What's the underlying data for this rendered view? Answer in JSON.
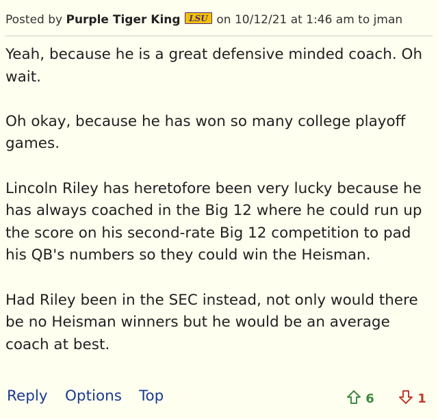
{
  "header": {
    "prefix": "Posted by",
    "author": "Purple Tiger King",
    "team_badge": "LSU",
    "date_text": "on 10/12/21 at 1:46 am to",
    "reply_to": "jman"
  },
  "body": {
    "paragraphs": [
      "Yeah, because he is a great defensive minded coach. Oh wait.",
      "Oh okay, because he has won so many college playoff games.",
      "Lincoln Riley has heretofore been very lucky because he has always coached in the Big 12 where he could run up the score on his second-rate Big 12 competition to pad his QB's numbers so they could win the Heisman.",
      "Had Riley been in the SEC instead, not only would there be no Heisman winners but he would be an average coach at best."
    ]
  },
  "actions": {
    "reply": "Reply",
    "options": "Options",
    "top": "Top"
  },
  "votes": {
    "up_count": "6",
    "down_count": "1",
    "up_icon": "arrow-up-icon",
    "down_icon": "arrow-down-icon",
    "up_color": "#3d8a3d",
    "down_color": "#c0392b"
  },
  "colors": {
    "background": "#fffff0",
    "link": "#1a3a8f",
    "badge_purple": "#4b2a7b",
    "badge_gold": "#f2c200"
  }
}
